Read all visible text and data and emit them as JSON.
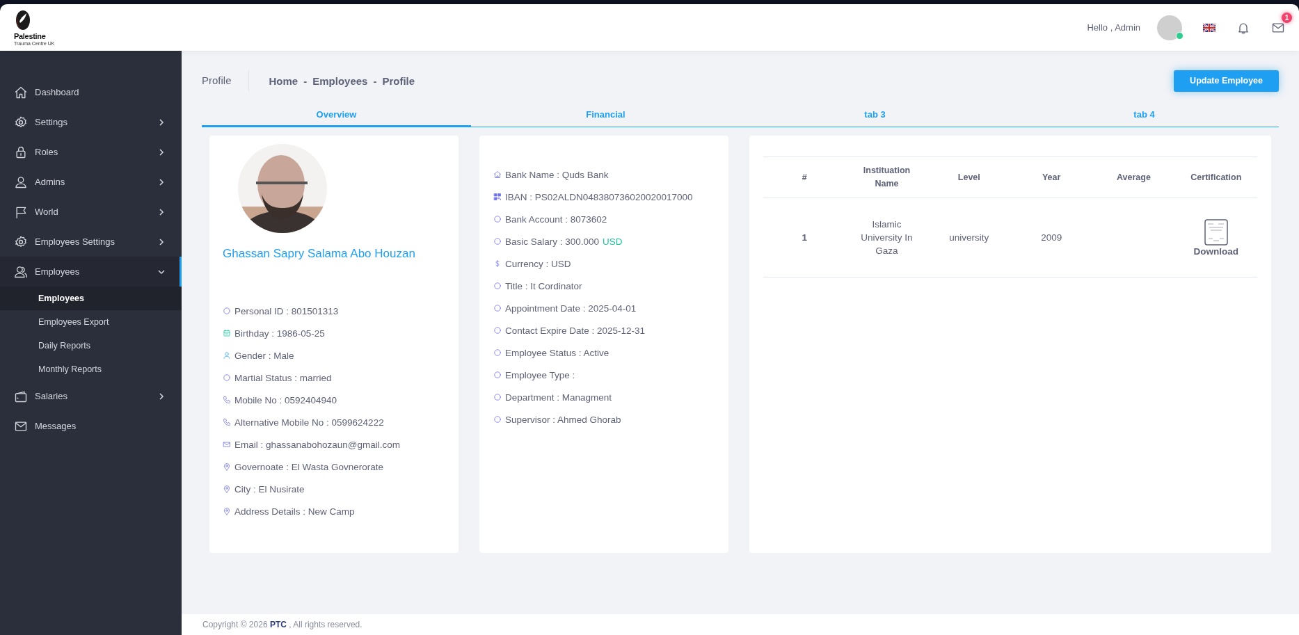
{
  "logo": {
    "name": "Palestine",
    "subtitle": "Trauma Centre UK"
  },
  "header": {
    "greeting": "Hello ,  Admin",
    "online": true,
    "mail_badge": "1"
  },
  "sidebar": {
    "items": [
      {
        "label": "Dashboard",
        "kind": "home",
        "selected": false
      },
      {
        "label": "Settings",
        "kind": "gear",
        "expanded": false,
        "selected": false
      },
      {
        "label": "Roles",
        "kind": "lock",
        "expanded": false,
        "selected": false
      },
      {
        "label": "Admins",
        "kind": "user",
        "expanded": false,
        "selected": false
      },
      {
        "label": "World",
        "kind": "flag",
        "expanded": false,
        "selected": false
      },
      {
        "label": "Employees Settings",
        "kind": "gear",
        "expanded": false,
        "selected": false
      },
      {
        "label": "Employees",
        "kind": "users",
        "expanded": true,
        "selected": true,
        "children": [
          {
            "label": "Employees",
            "selected": true
          },
          {
            "label": "Employees Export",
            "selected": false
          },
          {
            "label": "Daily Reports",
            "selected": false
          },
          {
            "label": "Monthly Reports",
            "selected": false
          }
        ]
      },
      {
        "label": "Salaries",
        "kind": "wallet",
        "expanded": false,
        "selected": false
      },
      {
        "label": "Messages",
        "kind": "mail",
        "selected": false
      }
    ]
  },
  "page_title": "Profile",
  "breadcrumb": {
    "items": [
      "Home",
      "Employees",
      "Profile"
    ],
    "separator": "-"
  },
  "update_button": "Update Employee",
  "tabs": [
    {
      "label": "Overview",
      "selected": true
    },
    {
      "label": "Financial",
      "selected": false
    },
    {
      "label": "tab 3",
      "selected": false
    },
    {
      "label": "tab 4",
      "selected": false
    }
  ],
  "profile": {
    "name": "Ghassan Sapry Salama Abo Houzan",
    "details": [
      {
        "kind": "circle",
        "text": "Personal ID : 801501313"
      },
      {
        "kind": "calendar",
        "text": "Birthday : 1986-05-25"
      },
      {
        "kind": "user",
        "text": "Gender : Male"
      },
      {
        "kind": "circle",
        "text": "Martial Status : married"
      },
      {
        "kind": "phone",
        "text": "Mobile No : 0592404940"
      },
      {
        "kind": "phone",
        "text": "Alternative Mobile No : 0599624222"
      },
      {
        "kind": "mail",
        "text": "Email : ghassanabohozaun@gmail.com"
      },
      {
        "kind": "pin",
        "text": "Governoate : El Wasta Govnerorate"
      },
      {
        "kind": "pin",
        "text": "City : El Nusirate"
      },
      {
        "kind": "pin",
        "text": "Address Details : New Camp"
      }
    ]
  },
  "financial": {
    "details": [
      {
        "kind": "home",
        "text": "Bank Name : Quds Bank"
      },
      {
        "kind": "qr",
        "text": "IBAN : PS02ALDN048380736020020017000"
      },
      {
        "kind": "circle",
        "text": "Bank Account : 8073602"
      },
      {
        "kind": "circle",
        "text": "Basic Salary : 300.000",
        "unit": "USD"
      },
      {
        "kind": "dollar",
        "text": "Currency : USD"
      },
      {
        "kind": "circle",
        "text": "Title : It Cordinator"
      },
      {
        "kind": "circle",
        "text": "Appointment Date : 2025-04-01"
      },
      {
        "kind": "circle",
        "text": "Contact Expire Date : 2025-12-31"
      },
      {
        "kind": "circle",
        "text": "Employee Status : Active"
      },
      {
        "kind": "circle",
        "text": "Employee Type :"
      },
      {
        "kind": "circle",
        "text": "Department : Managment"
      },
      {
        "kind": "circle",
        "text": "Supervisor : Ahmed Ghorab"
      }
    ]
  },
  "education": {
    "columns": [
      "#",
      "Instituation Name",
      "Level",
      "Year",
      "Average",
      "Certification"
    ],
    "rows": [
      {
        "number": "1",
        "institution": "Islamic University In Gaza",
        "level": "university",
        "year": "2009",
        "certification": "Download"
      }
    ]
  },
  "footer": "Copyright © 2026 **PTC** , All rights reserved."
}
